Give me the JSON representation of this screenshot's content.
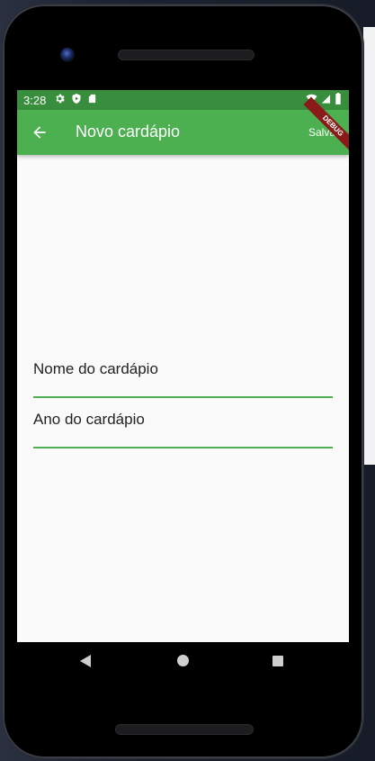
{
  "status_bar": {
    "time": "3:28",
    "icons": [
      "gear-icon",
      "shield-icon",
      "sd-card-icon"
    ],
    "right_icons": [
      "wifi-icon",
      "signal-icon",
      "battery-icon"
    ]
  },
  "app_bar": {
    "back_icon": "arrow-back-icon",
    "title": "Novo cardápio",
    "save_label": "Salvar",
    "debug_banner": "DEBUG"
  },
  "form": {
    "fields": [
      {
        "label": "Nome do cardápio"
      },
      {
        "label": "Ano do cardápio"
      }
    ]
  },
  "navigation": {
    "buttons": [
      "back",
      "home",
      "recents"
    ]
  },
  "colors": {
    "primary": "#4caf50",
    "primary_dark": "#388e3c",
    "background": "#fafafa"
  }
}
